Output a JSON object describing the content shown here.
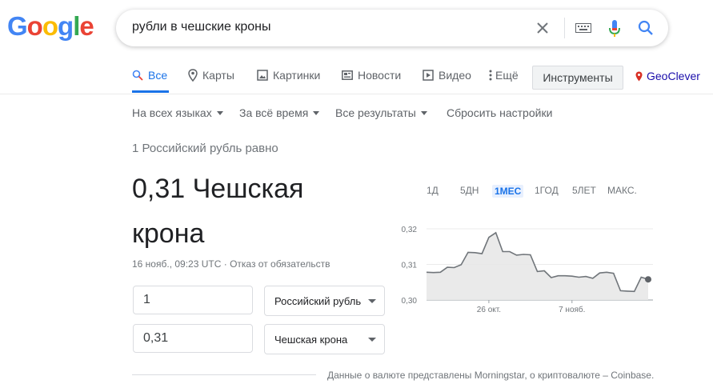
{
  "logo": {
    "letters": [
      "G",
      "o",
      "o",
      "g",
      "l",
      "e"
    ],
    "colors": [
      "#4285f4",
      "#ea4335",
      "#fbbc05",
      "#4285f4",
      "#34a853",
      "#ea4335"
    ]
  },
  "search": {
    "query": "рубли в чешские кроны"
  },
  "tabs": [
    {
      "label": "Все",
      "icon": "search-icon",
      "active": true
    },
    {
      "label": "Карты",
      "icon": "map-pin-icon"
    },
    {
      "label": "Картинки",
      "icon": "image-icon"
    },
    {
      "label": "Новости",
      "icon": "news-icon"
    },
    {
      "label": "Видео",
      "icon": "play-icon"
    },
    {
      "label": "Ещё",
      "icon": "more-vert-icon"
    }
  ],
  "tools_label": "Инструменты",
  "extension_label": "GeoClever",
  "filters": [
    "На всех языках",
    "За всё время",
    "Все результаты",
    "Сбросить настройки"
  ],
  "converter": {
    "equals_text": "1 Российский рубль равно",
    "result_line1": "0,31 Чешская",
    "result_line2": "крона",
    "timestamp": "16 нояб., 09:23 UTC",
    "disclaimer": "Отказ от обязательств",
    "amount_from": "1",
    "amount_to": "0,31",
    "currency_from": "Российский рубль",
    "currency_to": "Чешская крона"
  },
  "ranges": [
    "1Д",
    "5ДН",
    "1МЕС",
    "1ГОД",
    "5ЛЕТ",
    "МАКС."
  ],
  "active_range": "1МЕС",
  "chart_data": {
    "type": "area",
    "y_ticks": [
      "0,32",
      "0,31",
      "0,30"
    ],
    "x_ticks": [
      "26 окт.",
      "7 нояб."
    ],
    "ylim": [
      0.3,
      0.32
    ],
    "values": [
      0.3078,
      0.3077,
      0.3078,
      0.3092,
      0.3091,
      0.3099,
      0.3134,
      0.3133,
      0.313,
      0.3176,
      0.3189,
      0.3136,
      0.3136,
      0.3126,
      0.3128,
      0.3127,
      0.308,
      0.3082,
      0.3063,
      0.3068,
      0.3068,
      0.3067,
      0.3064,
      0.3066,
      0.3061,
      0.3076,
      0.3078,
      0.3075,
      0.3026,
      0.3025,
      0.3024,
      0.3064,
      0.3058
    ],
    "line_color": "#70757a",
    "fill_color": "#e8e8e8"
  },
  "footnote": "Данные о валюте представлены Morningstar, о криптовалюте – Coinbase."
}
